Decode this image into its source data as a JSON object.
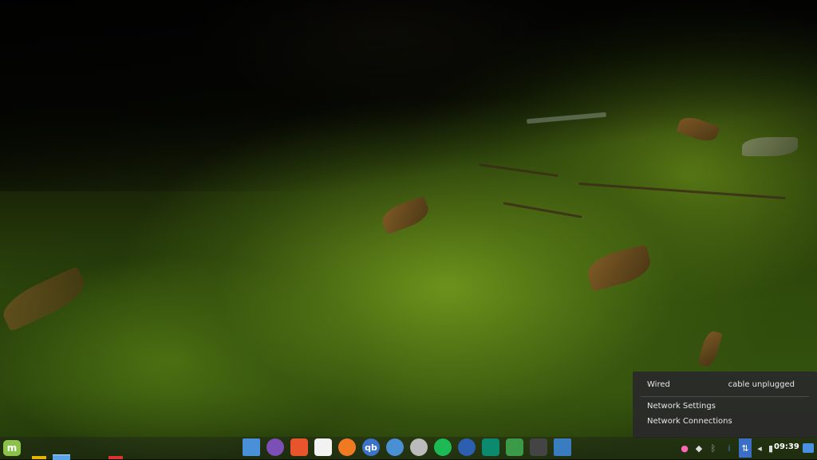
{
  "network_popup": {
    "wired_label": "Wired",
    "wired_status": "cable unplugged",
    "items": [
      "Network Settings",
      "Network Connections"
    ]
  },
  "panel": {
    "menu_icon": "linux-mint-menu-icon",
    "menu_letter": "m",
    "launchers": [
      {
        "name": "files-icon",
        "color": "#4a90d9",
        "glyph": ""
      },
      {
        "name": "pidgin-icon",
        "color": "#7b4fb5",
        "glyph": ""
      },
      {
        "name": "brave-icon",
        "color": "#e8542c",
        "glyph": ""
      },
      {
        "name": "text-editor-icon",
        "color": "#f2f2f2",
        "glyph": ""
      },
      {
        "name": "firefox-icon",
        "color": "#f07a22",
        "glyph": ""
      },
      {
        "name": "qbittorrent-icon",
        "color": "#3b73c8",
        "glyph": "qb"
      },
      {
        "name": "weather-icon",
        "color": "#4a8fd4",
        "glyph": ""
      },
      {
        "name": "pop-icon",
        "color": "#bbbbbb",
        "glyph": ""
      },
      {
        "name": "spotify-icon",
        "color": "#1db954",
        "glyph": ""
      },
      {
        "name": "night-mode-icon",
        "color": "#2d5fb0",
        "glyph": ""
      },
      {
        "name": "book-icon",
        "color": "#0b8a6f",
        "glyph": ""
      },
      {
        "name": "ghost-icon",
        "color": "#3a9a48",
        "glyph": ""
      },
      {
        "name": "terminal-icon",
        "color": "#444444",
        "glyph": ""
      },
      {
        "name": "screenshot-icon",
        "color": "#3a7cc0",
        "glyph": ""
      }
    ],
    "tray": [
      {
        "name": "bulb-icon",
        "glyph": "●",
        "color": "#ff66b3"
      },
      {
        "name": "shield-icon",
        "glyph": "◆",
        "color": "#dddddd"
      },
      {
        "name": "bluetooth-icon",
        "glyph": "ᛒ",
        "color": "#aaaaaa"
      },
      {
        "name": "intel-icon",
        "glyph": "i",
        "color": "#3a7cd6"
      },
      {
        "name": "network-icon",
        "glyph": "⇅",
        "color": "#ffffff"
      },
      {
        "name": "volume-icon",
        "glyph": "◂",
        "color": "#dddddd"
      },
      {
        "name": "battery-icon",
        "glyph": "▮",
        "color": "#dddddd"
      }
    ],
    "clock": "09:39",
    "notification_icon": "notification-icon"
  }
}
